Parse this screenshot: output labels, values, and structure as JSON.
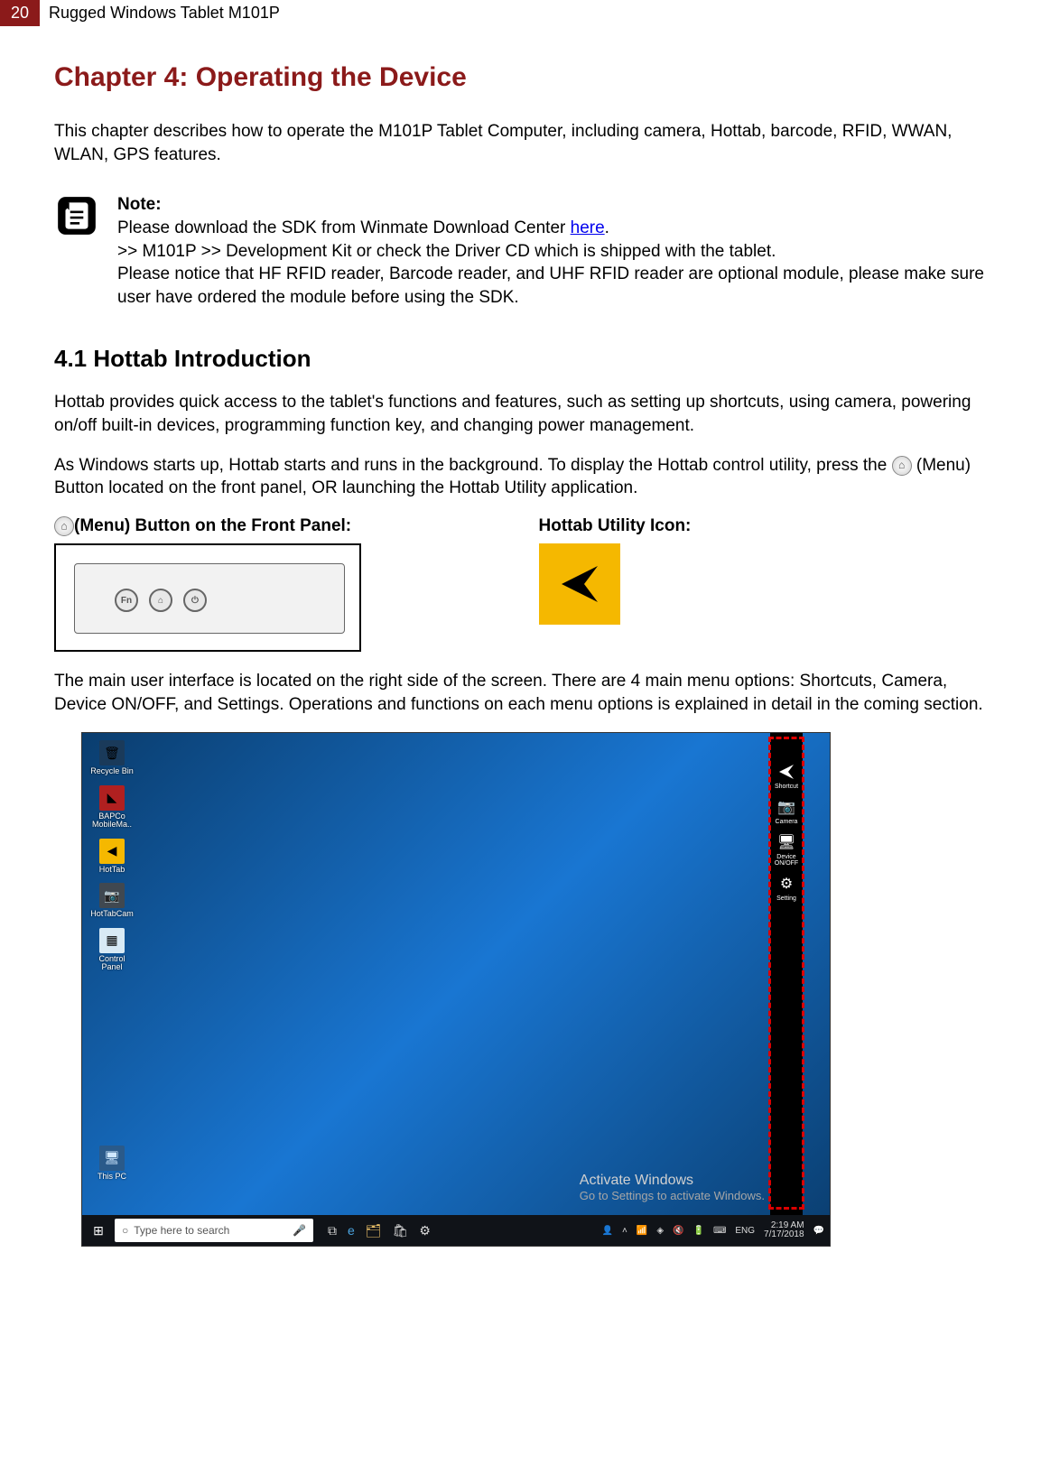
{
  "header": {
    "pageNum": "20",
    "docTitle": "Rugged Windows Tablet M101P"
  },
  "chapterTitle": "Chapter 4: Operating the Device",
  "intro": "This chapter describes how to operate the M101P Tablet Computer, including camera, Hottab, barcode, RFID, WWAN, WLAN, GPS features.",
  "note": {
    "label": "Note:",
    "line1a": "Please download the SDK from Winmate Download Center ",
    "link": "here",
    "line1b": ".",
    "line2": " >> M101P >> Development Kit or check the Driver CD which is shipped with the tablet.",
    "line3": "Please notice that HF RFID reader, Barcode reader, and UHF RFID reader are optional module, please make sure user have ordered the module before using the SDK."
  },
  "sectionTitle": "4.1 Hottab Introduction",
  "para1": "Hottab provides quick access to the tablet's functions and features, such as setting up shortcuts, using camera, powering on/off built-in devices, programming function key, and changing power management.",
  "para2a": "As Windows starts up, Hottab starts and runs in the background. To display the Hottab control utility, press the ",
  "para2b": " (Menu) Button located on the front panel, OR launching the Hottab Utility application.",
  "leftColLabel": "(Menu) Button on the Front Panel:",
  "rightColLabel": "Hottab Utility Icon:",
  "para3": "The main user interface is located on the right side of the screen. There are 4 main menu options: Shortcuts, Camera, Device ON/OFF, and Settings. Operations and functions on each menu options is explained in detail in the coming section.",
  "screenshot": {
    "desktopIcons": [
      {
        "label": "Recycle Bin",
        "bg": "#1a3a5a",
        "glyph": "🗑"
      },
      {
        "label": "BAPCo MobileMa..",
        "bg": "#b02020",
        "glyph": "◣"
      },
      {
        "label": "HotTab",
        "bg": "#f5b800",
        "glyph": "◀"
      },
      {
        "label": "HotTabCam",
        "bg": "#404850",
        "glyph": "📷"
      },
      {
        "label": "Control Panel",
        "bg": "#d8eaf5",
        "glyph": "▦"
      }
    ],
    "thisPC": "This PC",
    "activate": {
      "title": "Activate Windows",
      "sub": "Go to Settings to activate Windows."
    },
    "sidebar": [
      {
        "label": "Shortcut"
      },
      {
        "label": "Camera"
      },
      {
        "label": "Device ON/OFF"
      },
      {
        "label": "Setting"
      }
    ],
    "taskbar": {
      "searchPlaceholder": "Type here to search",
      "lang": "ENG",
      "time": "2:19 AM",
      "date": "7/17/2018"
    },
    "panelButtons": [
      "Fn",
      "⌂",
      "⏻"
    ]
  }
}
